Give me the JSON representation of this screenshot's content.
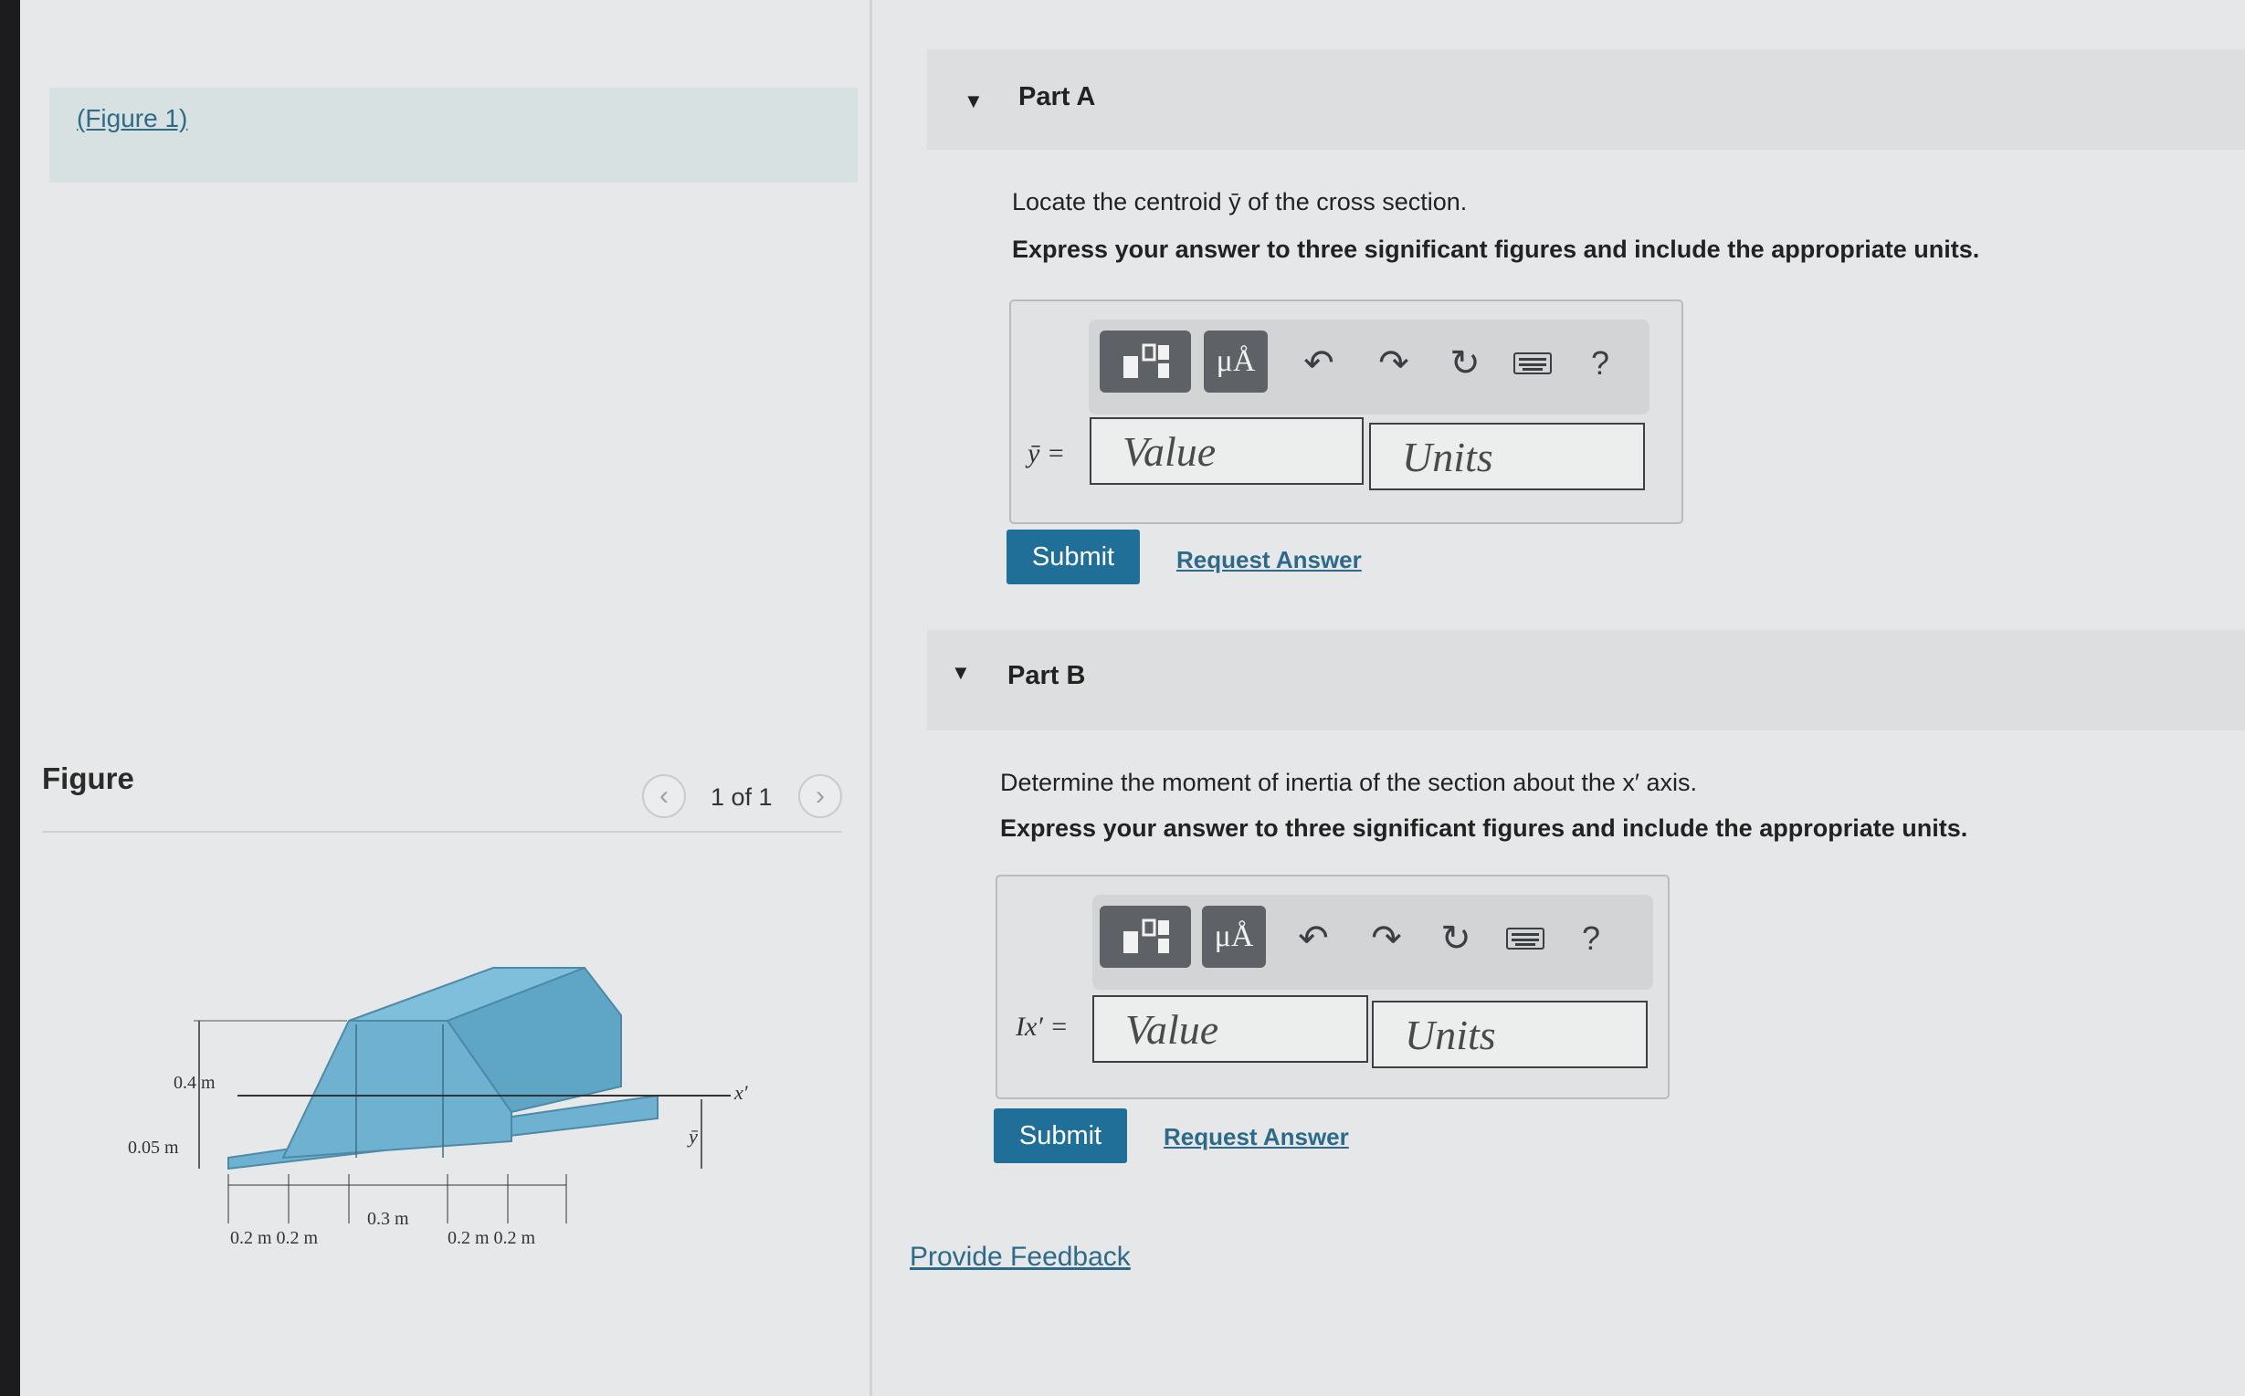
{
  "left": {
    "figure_link": "(Figure 1)",
    "figure_title": "Figure",
    "page_count": "1 of 1",
    "prev_icon": "chevron-left-icon",
    "next_icon": "chevron-right-icon",
    "figure_labels": {
      "dim_04": "0.4 m",
      "dim_005": "0.05 m",
      "dim_bottom_left": "0.2 m 0.2 m",
      "dim_middle": "0.3 m",
      "dim_bottom_right": "0.2 m 0.2 m",
      "axis_x": "x′",
      "axis_ybar": "ȳ"
    }
  },
  "part_a": {
    "title": "Part A",
    "question": "Locate the centroid ȳ of the cross section.",
    "instructions": "Express your answer to three significant figures and include the appropriate units.",
    "toolbar": {
      "mu_label": "μÅ",
      "help_label": "?"
    },
    "var_label": "ȳ =",
    "value_placeholder": "Value",
    "units_placeholder": "Units",
    "submit_label": "Submit",
    "request_label": "Request Answer"
  },
  "part_b": {
    "title": "Part B",
    "question": "Determine the moment of inertia of the section about the x′ axis.",
    "instructions": "Express your answer to three significant figures and include the appropriate units.",
    "toolbar": {
      "mu_label": "μÅ",
      "help_label": "?"
    },
    "var_label": "Ix′ =",
    "value_placeholder": "Value",
    "units_placeholder": "Units",
    "submit_label": "Submit",
    "request_label": "Request Answer"
  },
  "feedback_label": "Provide Feedback",
  "colors": {
    "accent": "#1f6f99",
    "link": "#2d6a8a",
    "figure_fill": "#6fb1d0"
  }
}
